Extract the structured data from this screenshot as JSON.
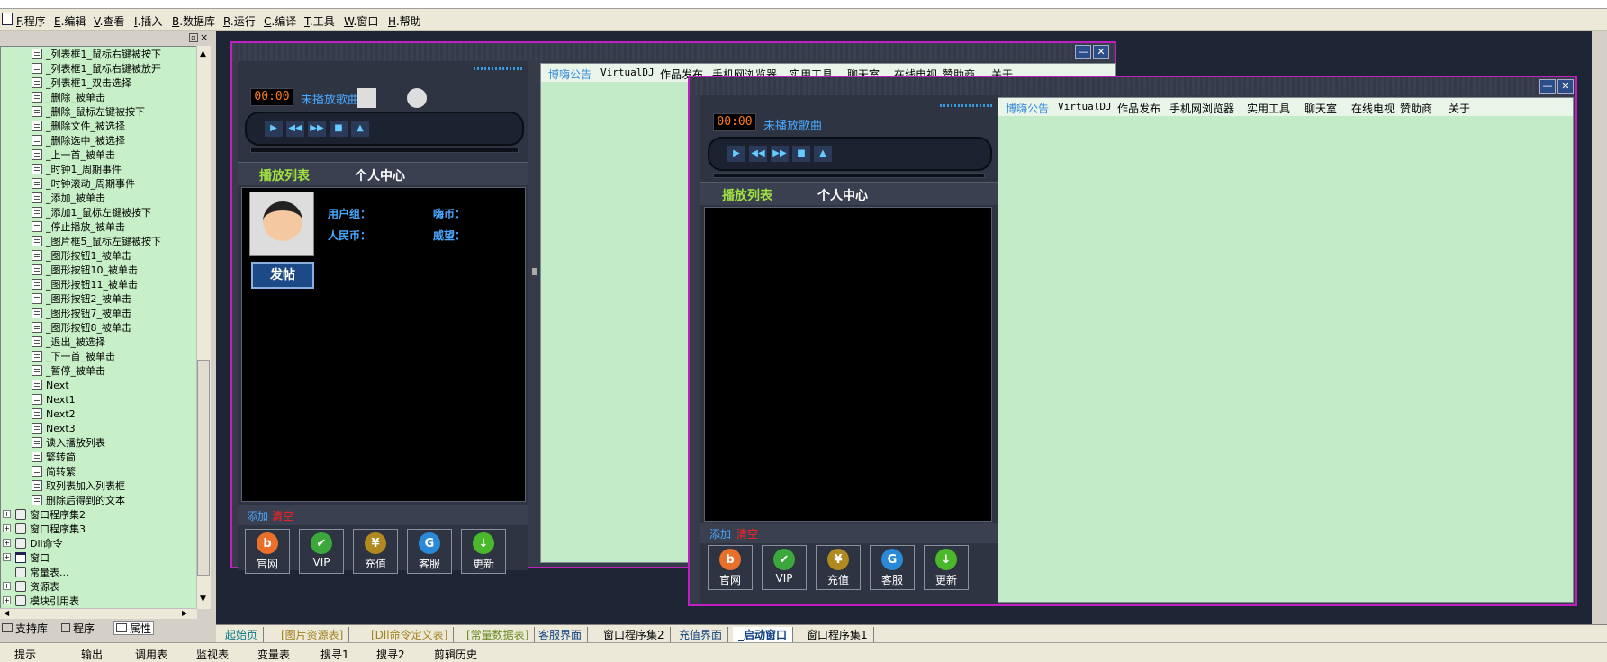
{
  "menu": [
    {
      "key": "F",
      "label": ".程序"
    },
    {
      "key": "E",
      "label": ".编辑"
    },
    {
      "key": "V",
      "label": ".查看"
    },
    {
      "key": "I",
      "label": ".插入"
    },
    {
      "key": "B",
      "label": ".数据库"
    },
    {
      "key": "R",
      "label": ".运行"
    },
    {
      "key": "C",
      "label": ".编译"
    },
    {
      "key": "T",
      "label": ".工具"
    },
    {
      "key": "W",
      "label": ".窗口"
    },
    {
      "key": "H",
      "label": ".帮助"
    }
  ],
  "tree": {
    "events": [
      "_列表框1_鼠标右键被按下",
      "_列表框1_鼠标右键被放开",
      "_列表框1_双击选择",
      "_删除_被单击",
      "_删除_鼠标左键被按下",
      "_删除文件_被选择",
      "_删除选中_被选择",
      "_上一首_被单击",
      "_时钟1_周期事件",
      "_时钟滚动_周期事件",
      "_添加_被单击",
      "_添加1_鼠标左键被按下",
      "_停止播放_被单击",
      "_图片框5_鼠标左键被按下",
      "_图形按钮1_被单击",
      "_图形按钮10_被单击",
      "_图形按钮11_被单击",
      "_图形按钮2_被单击",
      "_图形按钮7_被单击",
      "_图形按钮8_被单击",
      "_退出_被选择",
      "_下一首_被单击",
      "_暂停_被单击",
      "Next",
      "Next1",
      "Next2",
      "Next3",
      "读入播放列表",
      "繁转简",
      "简转繁",
      "取列表加入列表框",
      "删除后得到的文本"
    ],
    "groups": [
      "窗口程序集2",
      "窗口程序集3",
      "Dll命令",
      "窗口",
      "常量表...",
      "资源表",
      "模块引用表"
    ]
  },
  "left_tabs": [
    "支持库",
    "程序",
    "属性"
  ],
  "bottom_tabs": [
    "起始页",
    "[图片资源表]",
    "[Dll命令定义表]",
    "[常量数据表]",
    "客服界面",
    "窗口程序集2",
    "充值界面",
    "_启动窗口",
    "窗口程序集1"
  ],
  "status_items": [
    "提示",
    "输出",
    "调用表",
    "监视表",
    "变量表",
    "搜寻1",
    "搜寻2",
    "剪辑历史"
  ],
  "player": {
    "time": "00:00",
    "song": "未播放歌曲",
    "tab_playlist": "播放列表",
    "tab_personal": "个人中心",
    "user_group": "用户组：",
    "rmb": "人民币：",
    "coin": "嗨币：",
    "prestige": "威望：",
    "post_button": "发帖",
    "add": "添加",
    "clear": "清空",
    "bottom_buttons": [
      {
        "label": "官网",
        "icon": "b",
        "color": "#e8702a"
      },
      {
        "label": "VIP",
        "icon": "✔",
        "color": "#3aa83a"
      },
      {
        "label": "充值",
        "icon": "¥",
        "color": "#b08a20"
      },
      {
        "label": "客服",
        "icon": "G",
        "color": "#2a8ad8"
      },
      {
        "label": "更新",
        "icon": "↓",
        "color": "#4ab82a"
      }
    ],
    "web_tabs": [
      "博嗨公告",
      "VirtualDJ",
      "作品发布",
      "手机网浏览器",
      "实用工具",
      "聊天室",
      "在线电视",
      "赞助商",
      "关于"
    ]
  },
  "colors": {
    "accent_tab": "#a0e040",
    "song_blue": "#4aa8ff",
    "lcd_orange": "#ff7a1a",
    "clear_red": "#ff2020",
    "add_blue": "#4aa8ff",
    "design_bg": "#1e2535",
    "border_magenta": "#c020c0"
  }
}
